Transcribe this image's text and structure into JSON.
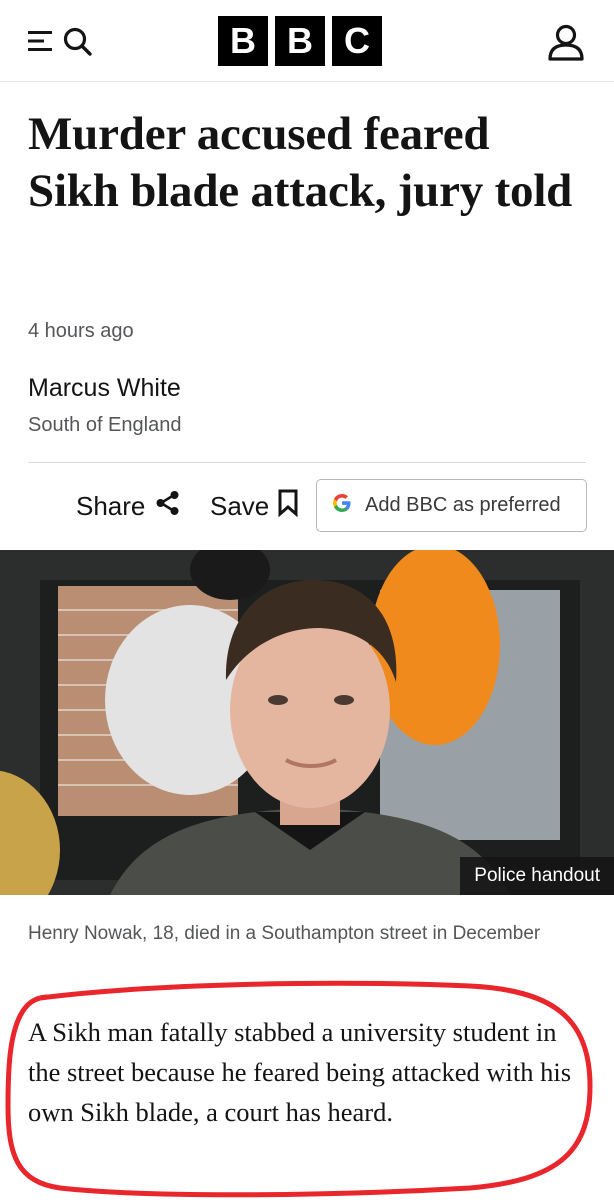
{
  "header": {
    "menu_icon": "menu-icon",
    "search_icon": "search-icon",
    "logo_letters": [
      "B",
      "B",
      "C"
    ],
    "account_icon": "user-account-icon"
  },
  "article": {
    "headline": "Murder accused feared Sikh blade attack, jury told",
    "timestamp": "4 hours ago",
    "author": "Marcus White",
    "region": "South of England",
    "actions": {
      "share_label": "Share",
      "save_label": "Save",
      "preferred_label": "Add BBC as preferred"
    },
    "image": {
      "credit": "Police handout",
      "caption": "Henry Nowak, 18, died in a Southampton street in December"
    },
    "lead": "A Sikh man fatally stabbed a university student in the street because he feared being attacked with his own Sikh blade, a court has heard."
  },
  "colors": {
    "text": "#141414",
    "muted": "#545658",
    "annotation_red": "#e8262b",
    "logo_bg": "#000000"
  }
}
